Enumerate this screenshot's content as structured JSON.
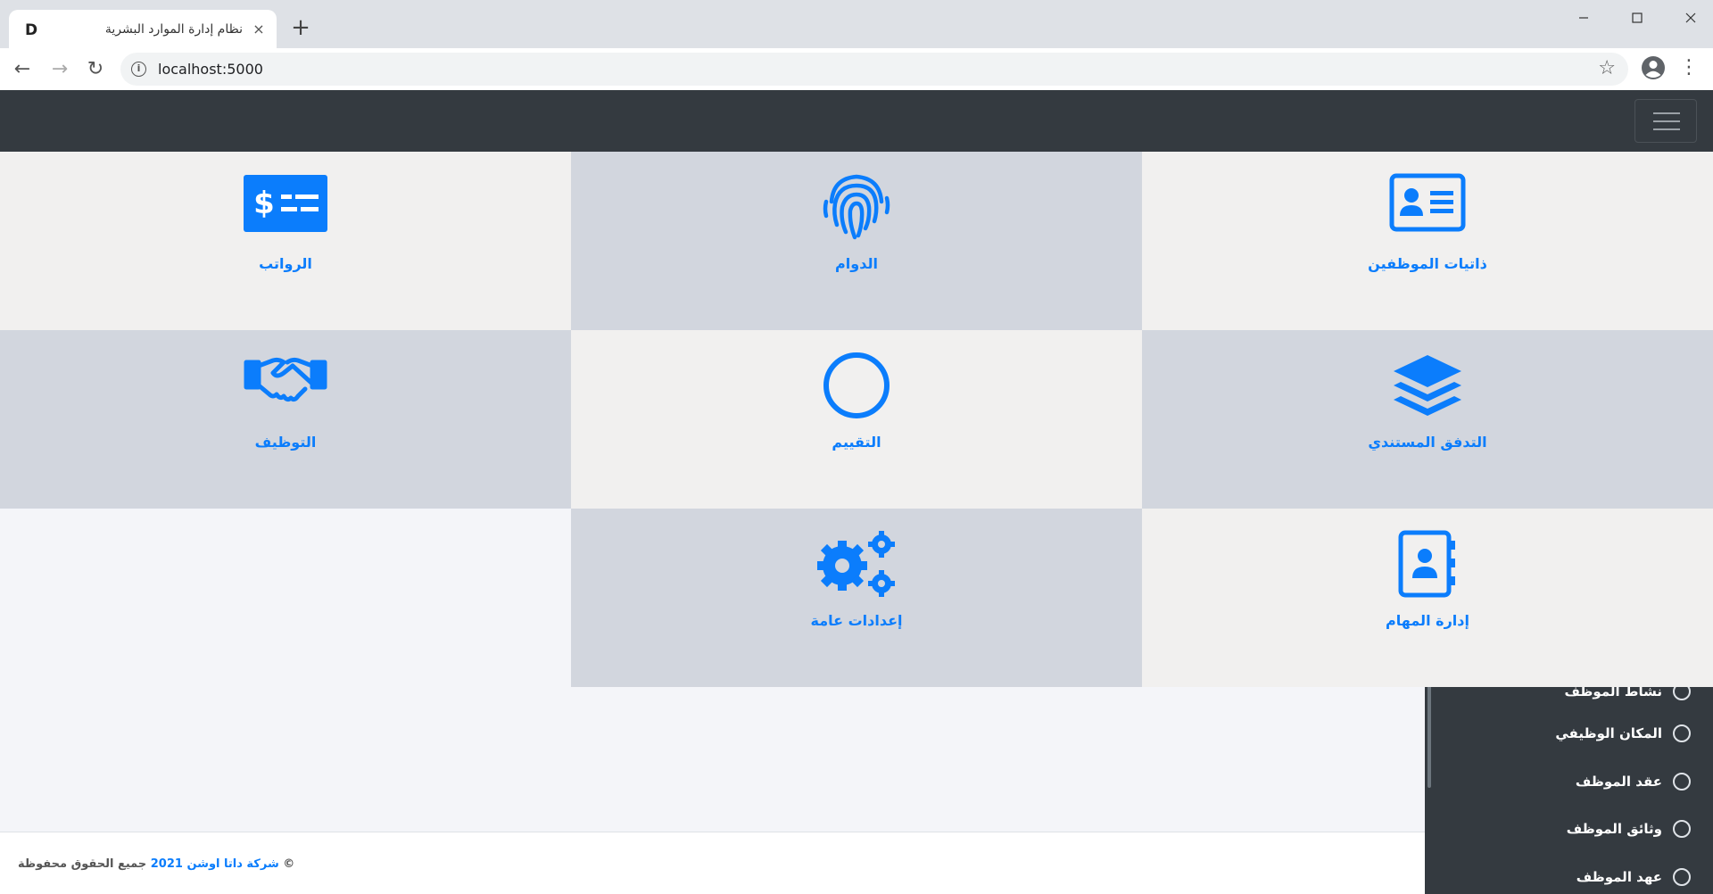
{
  "browser": {
    "tab_favicon": "D",
    "tab_title": "نظام إدارة الموارد البشرية",
    "tab_close": "×",
    "new_tab": "+",
    "url": "localhost:5000",
    "window_controls": {
      "minimize": "—",
      "maximize": "☐",
      "close": "✕"
    },
    "nav": {
      "back": "←",
      "forward": "→",
      "reload": "↻",
      "star": "☆",
      "menu": "⋮"
    }
  },
  "grid": {
    "tiles": [
      {
        "label": "ذاتيات الموظفين",
        "icon": "id-card-icon"
      },
      {
        "label": "الدوام",
        "icon": "fingerprint-icon"
      },
      {
        "label": "الرواتب",
        "icon": "money-check-icon"
      },
      {
        "label": "التدفق المستندي",
        "icon": "layers-icon"
      },
      {
        "label": "التقييم",
        "icon": "circle-icon"
      },
      {
        "label": "التوظيف",
        "icon": "handshake-icon"
      },
      {
        "label": "إدارة المهام",
        "icon": "address-book-icon"
      },
      {
        "label": "إعدادات عامة",
        "icon": "cogs-icon"
      }
    ]
  },
  "sidebar": {
    "items": [
      {
        "label": "نشاط الموظف"
      },
      {
        "label": "المكان الوظيفي"
      },
      {
        "label": "عقد الموظف"
      },
      {
        "label": "وثائق الموظف"
      },
      {
        "label": "عهد الموظف"
      }
    ]
  },
  "footer": {
    "copyright_symbol": "©",
    "company": "شركة داتا اوشن 2021",
    "rights": "جميع الحقوق محفوظة"
  },
  "colors": {
    "accent": "#0b7dfc",
    "navbar": "#343a40",
    "tile_light": "#f1f0ef",
    "tile_dark": "#d2d6de"
  }
}
